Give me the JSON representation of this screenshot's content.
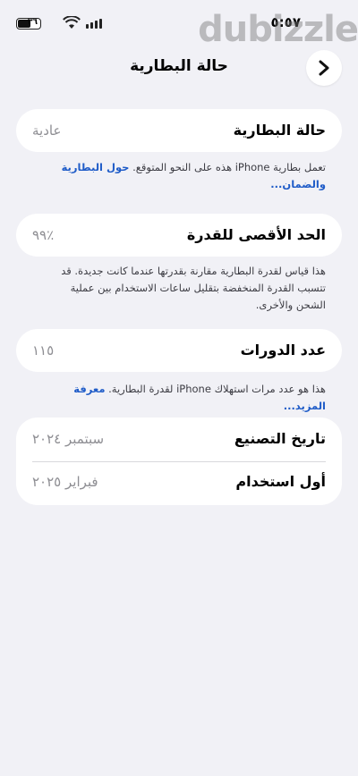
{
  "status_bar": {
    "time": "٥:٥٧",
    "battery_level": "٣٦"
  },
  "watermark": "dubizzle",
  "nav": {
    "title": "حالة البطارية"
  },
  "health": {
    "label": "حالة البطارية",
    "value": "عادية",
    "note": "تعمل بطارية iPhone هذه على النحو المتوقع.",
    "link_line1": "حول البطارية",
    "link_line2": "والضمان..."
  },
  "max_capacity": {
    "label": "الحد الأقصى للقدرة",
    "value": "٪٩٩",
    "note_lines": [
      "هذا قياس لقدرة البطارية مقارنة بقدرتها عندما كانت جديدة. قد",
      "تتسبب القدرة المنخفضة بتقليل ساعات الاستخدام بين عملية",
      "الشحن والأخرى."
    ]
  },
  "cycle_count": {
    "label": "عدد الدورات",
    "value": "١١٥",
    "note": "هذا هو عدد مرات استهلاك iPhone لقدرة البطارية.",
    "link": "معرفة المزيد..."
  },
  "dates": {
    "manufacture_label": "تاريخ التصنيع",
    "manufacture_value": "سبتمبر ٢٠٢٤",
    "first_use_label": "أول استخدام",
    "first_use_value": "فبراير ٢٠٢٥"
  }
}
